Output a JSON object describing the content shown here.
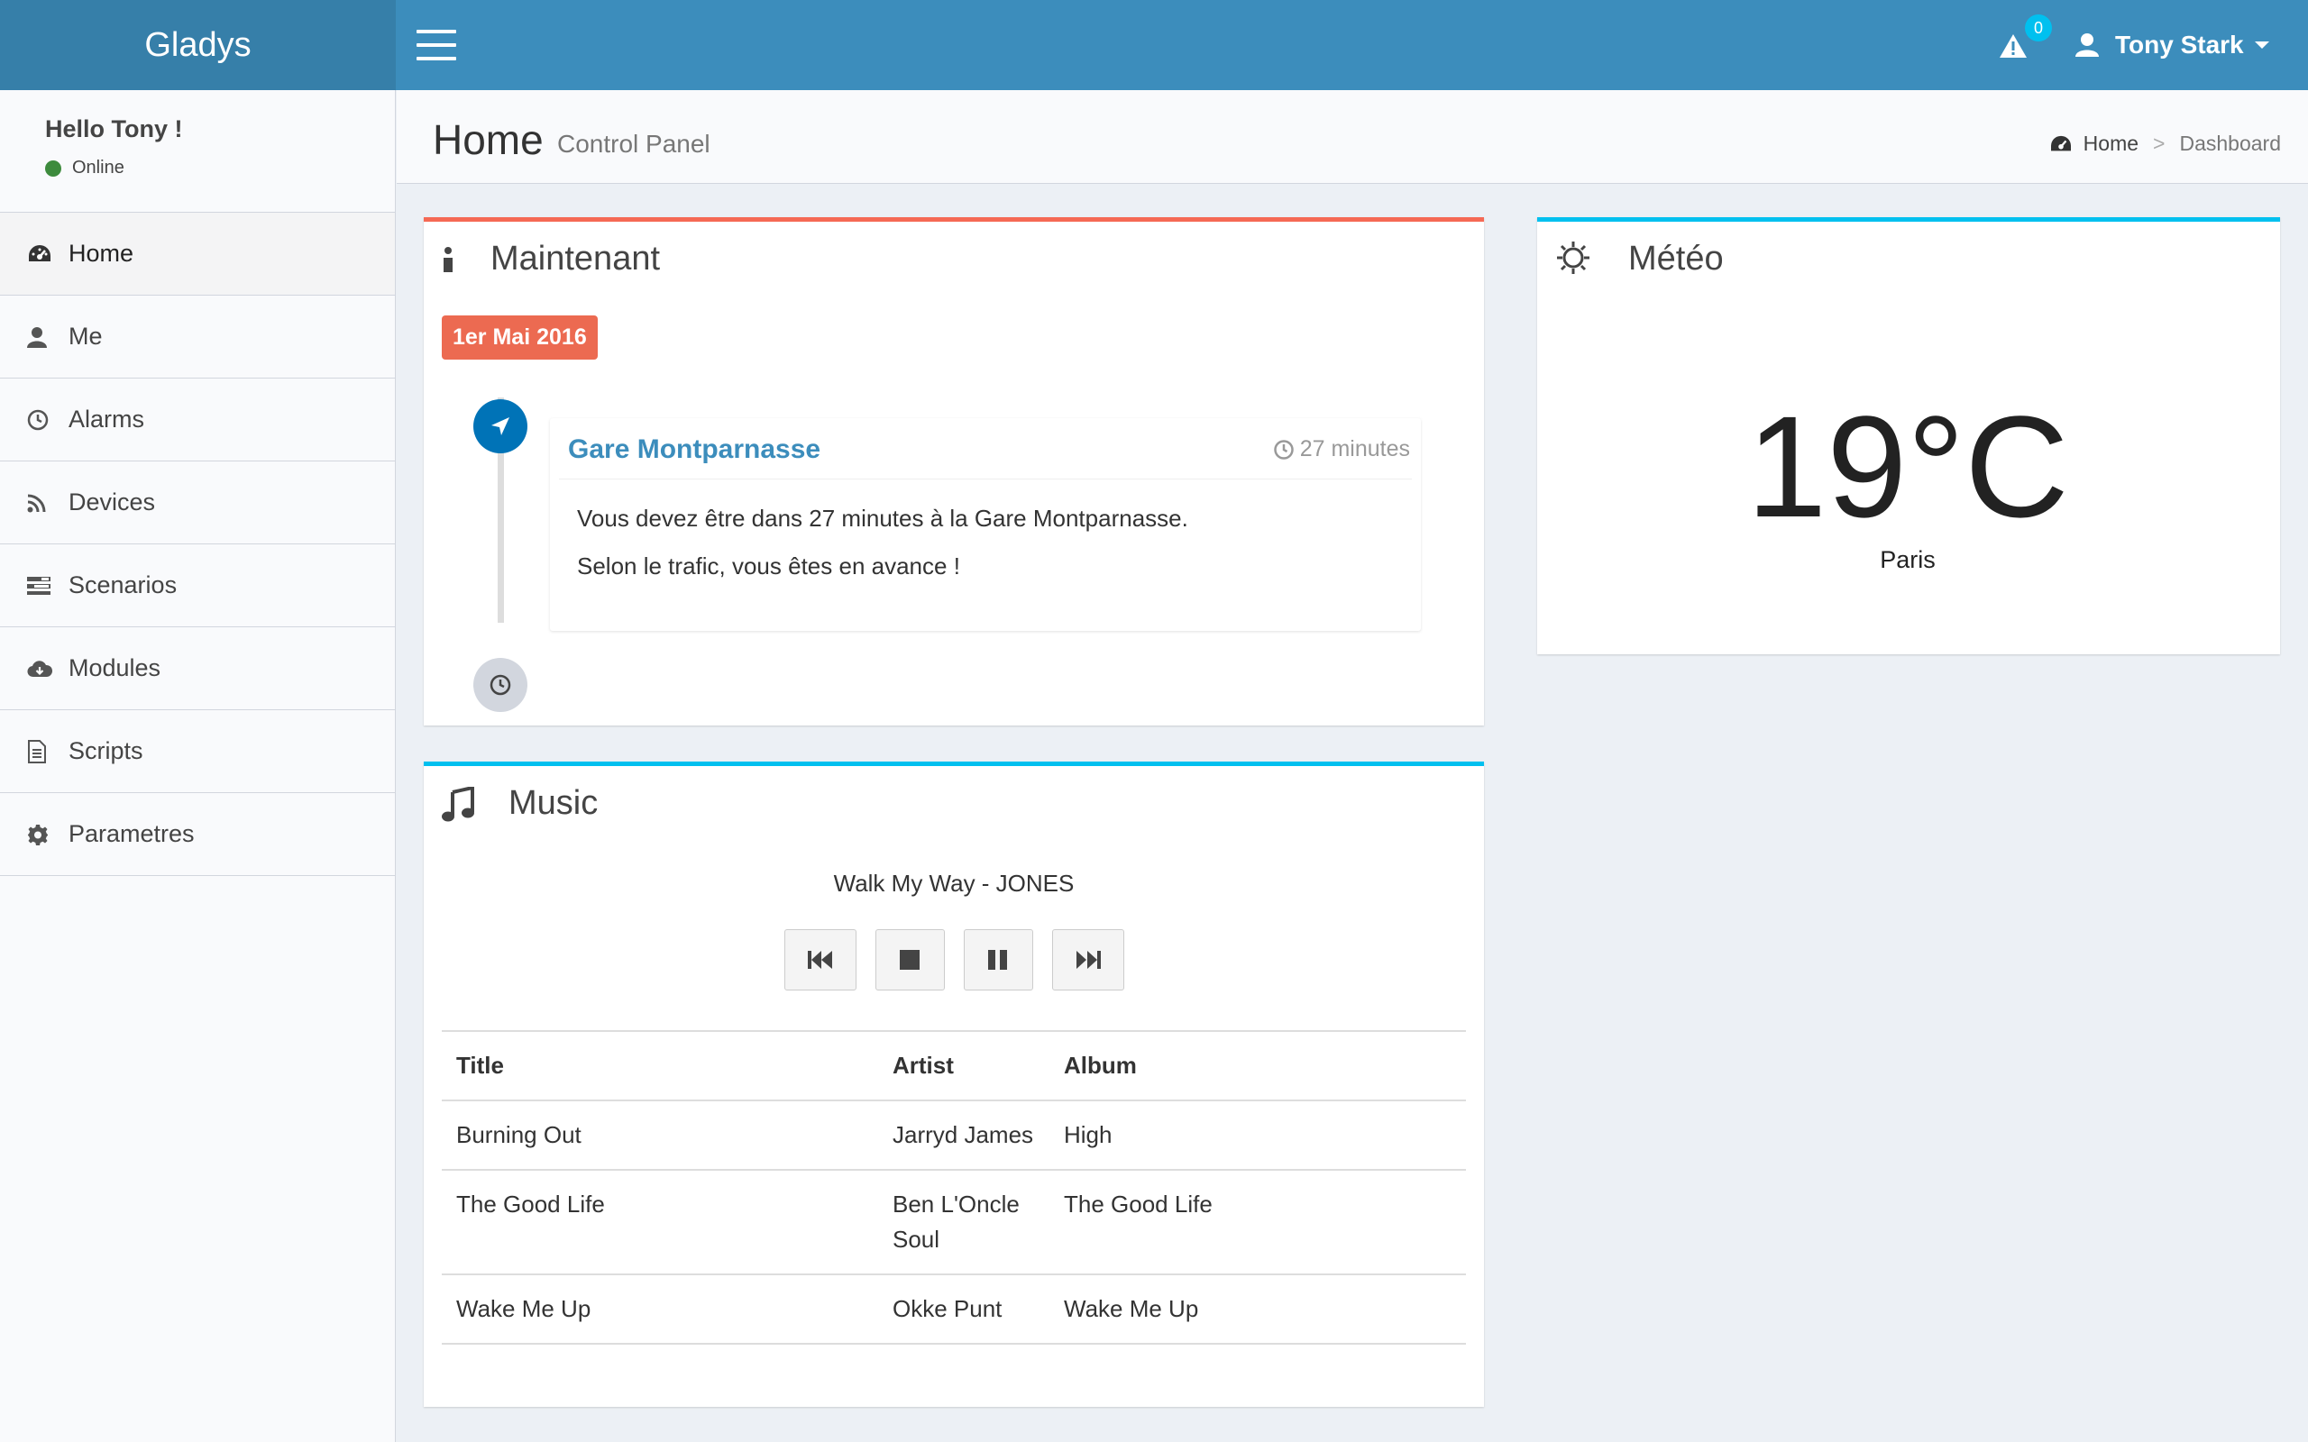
{
  "app": {
    "name": "Gladys"
  },
  "header": {
    "notification_count": "0",
    "user_name": "Tony Stark"
  },
  "sidebar": {
    "greeting": "Hello Tony !",
    "status": "Online",
    "items": [
      {
        "label": "Home",
        "icon": "dashboard-icon"
      },
      {
        "label": "Me",
        "icon": "user-icon"
      },
      {
        "label": "Alarms",
        "icon": "clock-icon"
      },
      {
        "label": "Devices",
        "icon": "rss-icon"
      },
      {
        "label": "Scenarios",
        "icon": "tasks-icon"
      },
      {
        "label": "Modules",
        "icon": "cloud-download-icon"
      },
      {
        "label": "Scripts",
        "icon": "file-icon"
      },
      {
        "label": "Parametres",
        "icon": "gear-icon"
      }
    ]
  },
  "page": {
    "title": "Home",
    "subtitle": "Control Panel",
    "breadcrumb": {
      "home": "Home",
      "separator": ">",
      "current": "Dashboard"
    }
  },
  "now_box": {
    "title": "Maintenant",
    "date": "1er Mai 2016",
    "event": {
      "title": "Gare Montparnasse",
      "time": "27 minutes",
      "line1": "Vous devez être dans 27 minutes à la Gare Montparnasse.",
      "line2": "Selon le trafic, vous êtes en avance !"
    }
  },
  "weather_box": {
    "title": "Météo",
    "temperature": "19°C",
    "city": "Paris"
  },
  "music_box": {
    "title": "Music",
    "now_playing": "Walk My Way - JONES",
    "columns": {
      "title": "Title",
      "artist": "Artist",
      "album": "Album"
    },
    "tracks": [
      {
        "title": "Burning Out",
        "artist": "Jarryd James",
        "album": "High"
      },
      {
        "title": "The Good Life",
        "artist": "Ben L'Oncle Soul",
        "album": "The Good Life"
      },
      {
        "title": "Wake Me Up",
        "artist": "Okke Punt",
        "album": "Wake Me Up"
      }
    ]
  },
  "colors": {
    "header": "#3c8dbc",
    "logo_bg": "#367fa9",
    "accent_info": "#00c0ef",
    "accent_danger": "#f56954",
    "date_label": "#ec6a51",
    "timeline_icon": "#0073b7",
    "online": "#3d8b3d"
  }
}
